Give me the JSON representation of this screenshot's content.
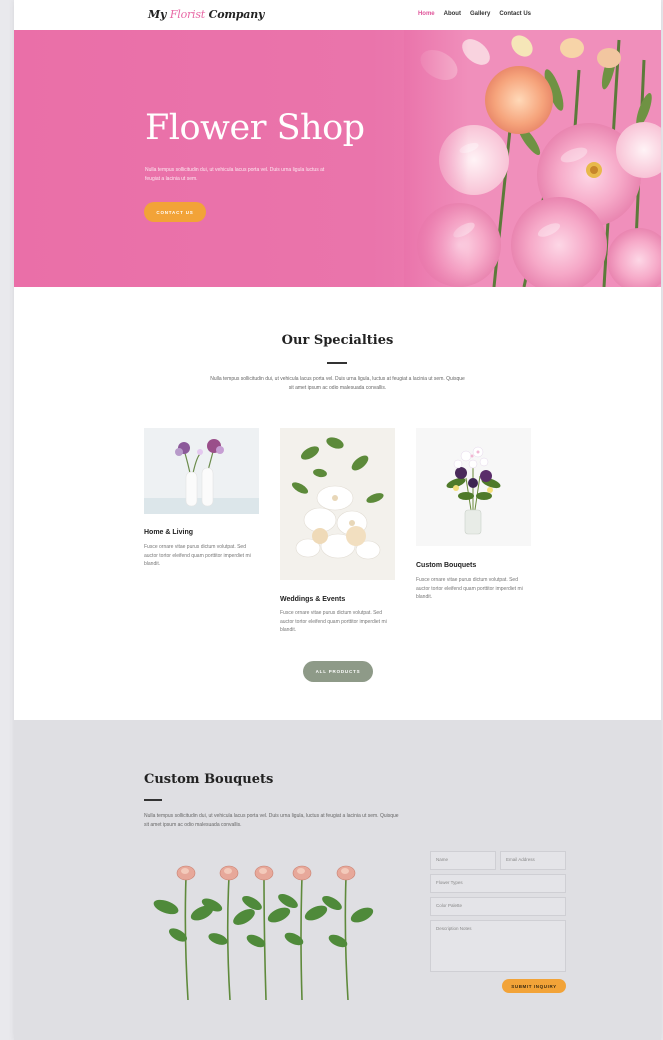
{
  "header": {
    "logo_main_1": "My ",
    "logo_accent": "Florist",
    "logo_main_2": " Company",
    "nav": [
      "Home",
      "About",
      "Gallery",
      "Contact Us"
    ]
  },
  "hero": {
    "title": "Flower Shop",
    "text": "Nulla tempus sollicitudin dui, ut vehicula lacus porta vel. Duis urna ligula luctus at feugiat a lacinia ut sem.",
    "button": "CONTACT US"
  },
  "specialties": {
    "title": "Our Specialties",
    "text": "Nulla tempus sollicitudin dui, ut vehicula lacus porta vel. Duis urna ligula, luctus at feugiat a lacinia ut sem. Quisque sit amet ipsum ac odio malesuada convallis.",
    "cards": [
      {
        "title": "Home & Living",
        "text": "Fusce ornare vitae purus dictum volutpat. Sed auctor tortor eleifend quam porttitor imperdiet mi blandit."
      },
      {
        "title": "Weddings & Events",
        "text": "Fusce ornare vitae purus dictum volutpat. Sed auctor tortor eleifend quam porttitor imperdiet mi blandit."
      },
      {
        "title": "Custom Bouquets",
        "text": "Fusce ornare vitae purus dictum volutpat. Sed auctor tortor eleifend quam porttitor imperdiet mi blandit."
      }
    ],
    "button": "ALL PRODUCTS"
  },
  "custom_bouquets": {
    "title": "Custom Bouquets",
    "text": "Nulla tempus sollicitudin dui, ut vehicula lacus porta vel. Duis urna ligula, luctus at feugiat a lacinia ut sem. Quisque sit amet ipsum ac odio malesuada convallis.",
    "form": {
      "name": "Name",
      "email": "Email Address",
      "flower_types": "Flower Types",
      "color_palette": "Color Palette",
      "description": "Description Notes",
      "submit": "SUBMIT INQUIRY"
    }
  },
  "colors": {
    "hero_pink": "#ea6fa8",
    "accent_orange": "#f2a338",
    "sage_button": "#8e9a88",
    "section_gray": "#dfdfe3"
  }
}
